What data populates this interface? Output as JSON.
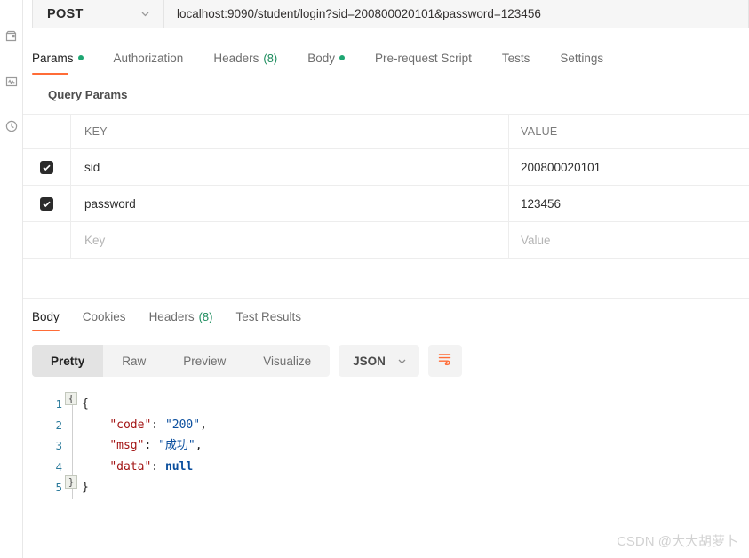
{
  "sidebar": {
    "items": [
      {
        "icon": "archive-box-icon",
        "name": "collections-rail-icon"
      },
      {
        "icon": "monitor-activity-icon",
        "name": "monitor-rail-icon"
      },
      {
        "icon": "clock-history-icon",
        "name": "history-rail-icon"
      }
    ]
  },
  "request": {
    "method": "POST",
    "method_chevron": "chevron-down-icon",
    "url": "localhost:9090/student/login?sid=200800020101&password=123456",
    "tabs": [
      {
        "label": "Params",
        "active": true,
        "dot": true,
        "count": ""
      },
      {
        "label": "Authorization",
        "active": false,
        "dot": false,
        "count": ""
      },
      {
        "label": "Headers",
        "active": false,
        "dot": false,
        "count": "(8)"
      },
      {
        "label": "Body",
        "active": false,
        "dot": true,
        "count": ""
      },
      {
        "label": "Pre-request Script",
        "active": false,
        "dot": false,
        "count": ""
      },
      {
        "label": "Tests",
        "active": false,
        "dot": false,
        "count": ""
      },
      {
        "label": "Settings",
        "active": false,
        "dot": false,
        "count": ""
      }
    ]
  },
  "query_params": {
    "section_title": "Query Params",
    "columns": {
      "key": "KEY",
      "value": "VALUE"
    },
    "rows": [
      {
        "checked": true,
        "key": "sid",
        "value": "200800020101",
        "placeholder_row": false
      },
      {
        "checked": true,
        "key": "password",
        "value": "123456",
        "placeholder_row": false
      },
      {
        "checked": false,
        "key": "Key",
        "value": "Value",
        "placeholder_row": true
      }
    ]
  },
  "response": {
    "tabs": [
      {
        "label": "Body",
        "active": true,
        "count": ""
      },
      {
        "label": "Cookies",
        "active": false,
        "count": ""
      },
      {
        "label": "Headers",
        "active": false,
        "count": "(8)"
      },
      {
        "label": "Test Results",
        "active": false,
        "count": ""
      }
    ],
    "view_modes": [
      {
        "label": "Pretty",
        "active": true
      },
      {
        "label": "Raw",
        "active": false
      },
      {
        "label": "Preview",
        "active": false
      },
      {
        "label": "Visualize",
        "active": false
      }
    ],
    "format": "JSON",
    "format_chevron": "chevron-down-icon",
    "wrap_button_icon": "wrap-text-icon",
    "body": {
      "line_numbers": [
        "1",
        "2",
        "3",
        "4",
        "5"
      ],
      "fold_open": "{",
      "fold_close": "}",
      "lines": [
        {
          "indent": 0,
          "tokens": [
            {
              "t": "punc",
              "v": "{"
            }
          ]
        },
        {
          "indent": 1,
          "tokens": [
            {
              "t": "key",
              "v": "\"code\""
            },
            {
              "t": "punc",
              "v": ": "
            },
            {
              "t": "str",
              "v": "\"200\""
            },
            {
              "t": "punc",
              "v": ","
            }
          ]
        },
        {
          "indent": 1,
          "tokens": [
            {
              "t": "key",
              "v": "\"msg\""
            },
            {
              "t": "punc",
              "v": ": "
            },
            {
              "t": "str",
              "v": "\"成功\""
            },
            {
              "t": "punc",
              "v": ","
            }
          ]
        },
        {
          "indent": 1,
          "tokens": [
            {
              "t": "key",
              "v": "\"data\""
            },
            {
              "t": "punc",
              "v": ": "
            },
            {
              "t": "null",
              "v": "null"
            }
          ]
        },
        {
          "indent": 0,
          "tokens": [
            {
              "t": "punc",
              "v": "}"
            }
          ]
        }
      ]
    }
  },
  "watermark": "CSDN @大大胡萝卜",
  "colors": {
    "accent": "#ff6c37",
    "green_dot": "#1ea672",
    "count_green": "#1c8c5d",
    "json_key": "#a31515",
    "json_string": "#0b4f9e",
    "line_number": "#2b7a9b"
  }
}
